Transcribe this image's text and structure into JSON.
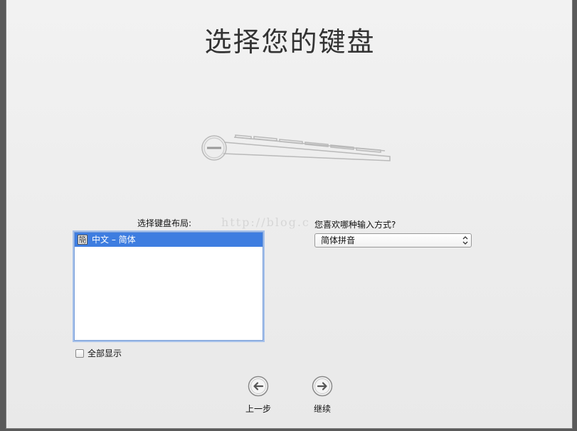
{
  "page": {
    "title": "选择您的键盘",
    "watermark": "http://blog.c"
  },
  "layout_section": {
    "label": "选择键盘布局:",
    "items": [
      {
        "badge": "簡",
        "label": "中文 – 简体",
        "selected": true
      }
    ],
    "show_all_label": "全部显示",
    "show_all_checked": false
  },
  "input_method": {
    "label": "您喜欢哪种输入方式?",
    "selected_value": "简体拼音"
  },
  "navigation": {
    "back_label": "上一步",
    "continue_label": "继续"
  },
  "icons": {
    "keyboard": "keyboard-illustration-icon",
    "back": "left-arrow-circle-icon",
    "continue": "right-arrow-circle-icon",
    "select": "up-down-chevron-icon"
  },
  "colors": {
    "selection": "#3e7de0",
    "focus_ring": "#a6c1ea"
  }
}
